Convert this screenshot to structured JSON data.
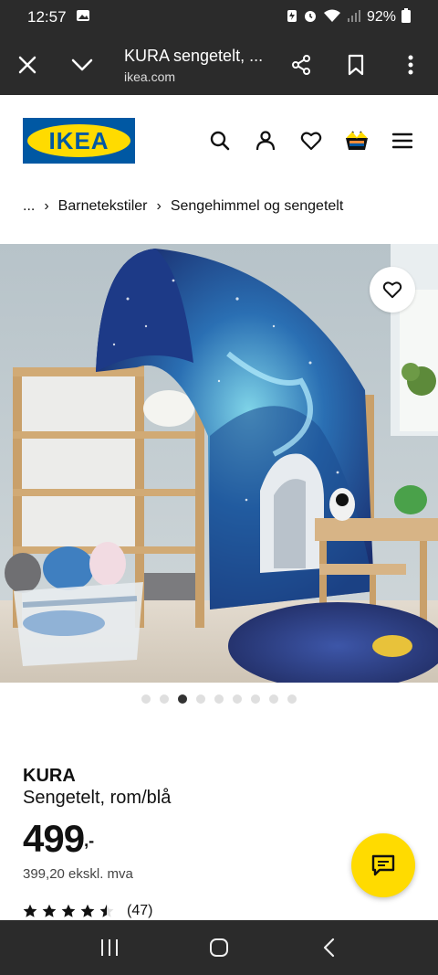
{
  "status_bar": {
    "time": "12:57",
    "battery": "92%",
    "icons": [
      "gallery-icon",
      "battery-saver-icon",
      "alarm-icon",
      "wifi-icon",
      "signal-icon",
      "battery-icon"
    ]
  },
  "browser": {
    "title": "KURA sengetelt, ...",
    "url": "ikea.com",
    "actions": [
      "close-icon",
      "chevron-down-icon",
      "share-icon",
      "bookmark-icon",
      "more-icon"
    ]
  },
  "header": {
    "logo_text": "IKEA",
    "colors": {
      "brand_blue": "#0058a3",
      "brand_yellow": "#ffdb00"
    },
    "icons": [
      "search-icon",
      "profile-icon",
      "heart-icon",
      "basket-icon",
      "menu-icon"
    ]
  },
  "breadcrumb": {
    "items": [
      "...",
      "Barnetekstiler",
      "Sengehimmel og sengetelt"
    ]
  },
  "gallery": {
    "image_count": 9,
    "active_index": 2
  },
  "product": {
    "name": "KURA",
    "description": "Sengetelt, rom/blå",
    "price_integer": "499",
    "price_suffix": ",-",
    "price_ex_vat": "399,20 ekskl. mva",
    "rating": 4.5,
    "rating_count": "(47)"
  },
  "nav_bar": {
    "icons": [
      "recents-icon",
      "home-icon",
      "back-icon"
    ]
  }
}
